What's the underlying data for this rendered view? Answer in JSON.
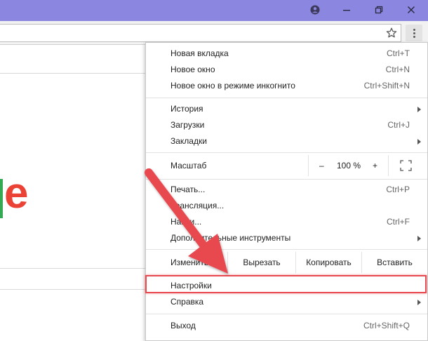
{
  "window": {
    "icons": [
      "account-icon",
      "minimize-icon",
      "restore-icon",
      "close-icon"
    ]
  },
  "toolbar": {
    "bookmark_icon": "star-icon",
    "menu_icon": "vertical-dots-icon"
  },
  "page": {
    "logo_fragment": "e"
  },
  "menu": {
    "new_tab": {
      "label": "Новая вкладка",
      "shortcut": "Ctrl+T"
    },
    "new_window": {
      "label": "Новое окно",
      "shortcut": "Ctrl+N"
    },
    "incognito": {
      "label": "Новое окно в режиме инкогнито",
      "shortcut": "Ctrl+Shift+N"
    },
    "history": {
      "label": "История"
    },
    "downloads": {
      "label": "Загрузки",
      "shortcut": "Ctrl+J"
    },
    "bookmarks": {
      "label": "Закладки"
    },
    "zoom": {
      "label": "Масштаб",
      "minus": "–",
      "value": "100 %",
      "plus": "+"
    },
    "print": {
      "label": "Печать...",
      "shortcut": "Ctrl+P"
    },
    "cast": {
      "label": "Трансляция..."
    },
    "find": {
      "label": "Найти...",
      "shortcut": "Ctrl+F"
    },
    "more_tools": {
      "label": "Дополнительные инструменты"
    },
    "edit": {
      "label": "Изменить",
      "cut": "Вырезать",
      "copy": "Копировать",
      "paste": "Вставить"
    },
    "settings": {
      "label": "Настройки"
    },
    "help": {
      "label": "Справка"
    },
    "exit": {
      "label": "Выход",
      "shortcut": "Ctrl+Shift+Q"
    }
  },
  "annotation": {
    "arrow_color": "#e8484f",
    "highlight_color": "#e8484f"
  }
}
